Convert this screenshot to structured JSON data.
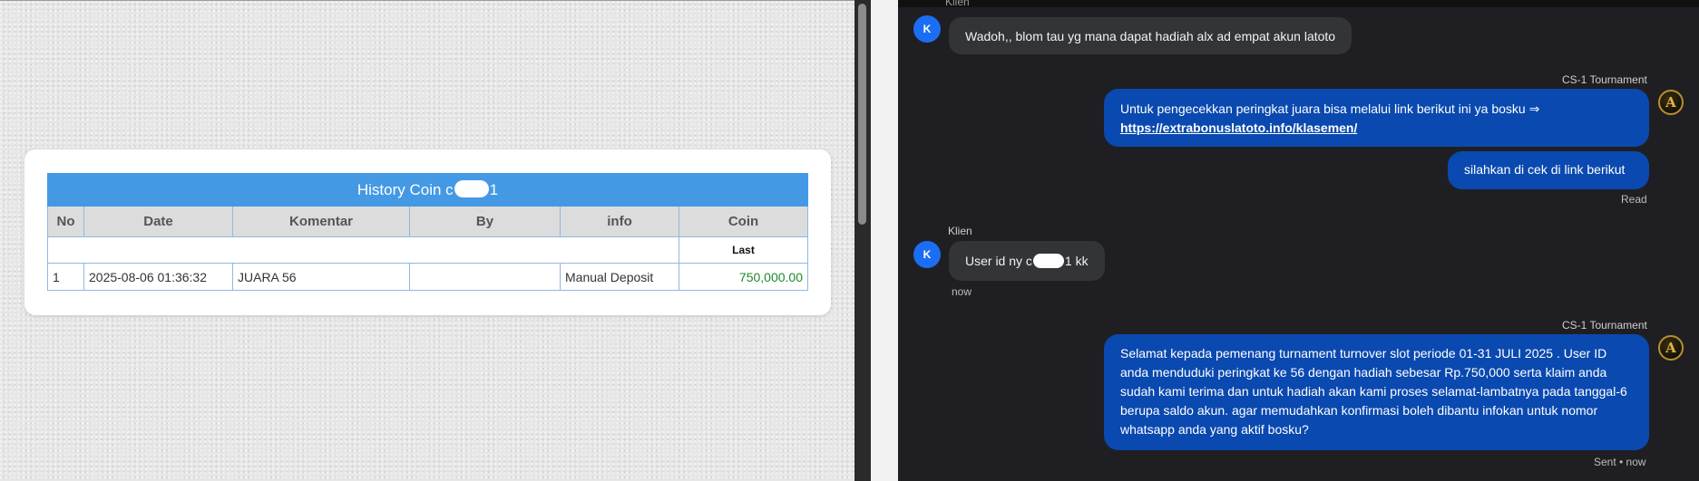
{
  "coin_history": {
    "title_prefix": "History Coin c",
    "title_suffix": "1",
    "columns": [
      "No",
      "Date",
      "Komentar",
      "By",
      "info",
      "Coin"
    ],
    "subheader_last": "Last",
    "rows": [
      {
        "no": "1",
        "date": "2025-08-06 01:36:32",
        "komentar": "JUARA 56",
        "by": "",
        "info": "Manual Deposit",
        "coin": "750,000.00"
      }
    ]
  },
  "chat": {
    "top_cut_sender": "Klien",
    "messages": [
      {
        "type": "incoming",
        "avatar": "K",
        "text": "Wadoh,, blom tau yg mana dapat hadiah alx ad empat akun latoto"
      },
      {
        "type": "outgoing",
        "sender": "CS-1 Tournament",
        "avatar": "A",
        "text": "Untuk pengecekkan peringkat juara bisa melalui link berikut ini ya bosku ⇒",
        "link": "https://extrabonuslatoto.info/klasemen/"
      },
      {
        "type": "outgoing",
        "text": "silahkan di cek di link berikut",
        "status": "Read"
      },
      {
        "type": "incoming",
        "sender": "Klien",
        "avatar": "K",
        "text_prefix": "User id ny c",
        "text_suffix": "1 kk",
        "time": "now"
      },
      {
        "type": "outgoing",
        "sender": "CS-1 Tournament",
        "avatar": "A",
        "text": "Selamat kepada pemenang turnament turnover slot periode 01-31 JULI 2025 . User ID anda menduduki peringkat ke 56 dengan hadiah sebesar Rp.750,000 serta klaim anda sudah kami terima dan untuk hadiah akan kami proses selamat-lambatnya pada tanggal-6 berupa saldo akun. agar memudahkan konfirmasi boleh dibantu infokan untuk nomor whatsapp anda yang aktif bosku?",
        "status": "Sent • now"
      }
    ]
  },
  "colors": {
    "table_header": "#4499e4",
    "incoming_bubble": "#333438",
    "outgoing_bubble": "#0a49b0",
    "avatar_blue": "#1b6ef3",
    "coin_green": "#1e8a2a"
  }
}
